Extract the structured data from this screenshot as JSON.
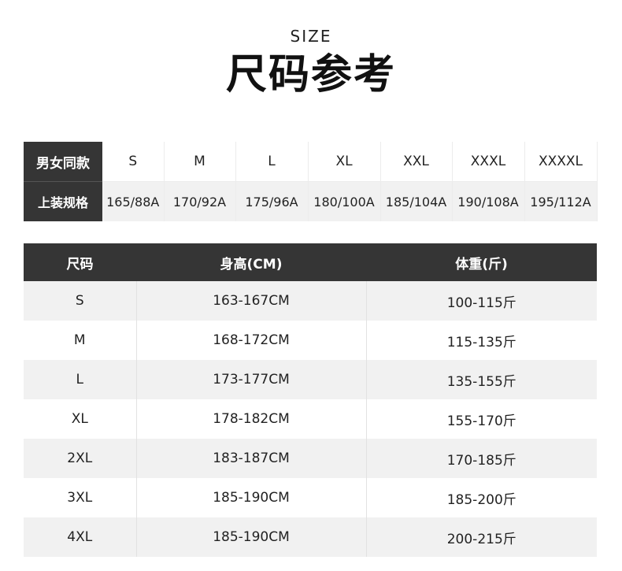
{
  "header": {
    "title_en": "SIZE",
    "title_cn": "尺码参考"
  },
  "spec_table": {
    "row1_label": "男女同款",
    "row2_label": "上装规格",
    "sizes": [
      "S",
      "M",
      "L",
      "XL",
      "XXL",
      "XXXL",
      "XXXXL"
    ],
    "specs": [
      "165/88A",
      "170/92A",
      "175/96A",
      "180/100A",
      "185/104A",
      "190/108A",
      "195/112A"
    ]
  },
  "size_table": {
    "headers": [
      "尺码",
      "身高(CM)",
      "体重(斤)"
    ],
    "rows": [
      [
        "S",
        "163-167CM",
        "100-115斤"
      ],
      [
        "M",
        "168-172CM",
        "115-135斤"
      ],
      [
        "L",
        "173-177CM",
        "135-155斤"
      ],
      [
        "XL",
        "178-182CM",
        "155-170斤"
      ],
      [
        "2XL",
        "183-187CM",
        "170-185斤"
      ],
      [
        "3XL",
        "185-190CM",
        "185-200斤"
      ],
      [
        "4XL",
        "185-190CM",
        "200-215斤"
      ]
    ]
  },
  "colors": {
    "header_bg": "#353535",
    "stripe_bg": "#f1f1f1",
    "text": "#222222"
  }
}
